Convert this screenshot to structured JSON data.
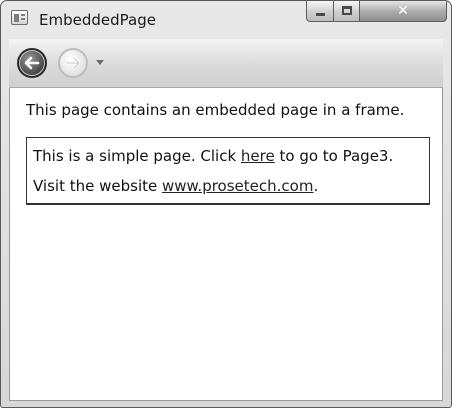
{
  "window": {
    "title": "EmbeddedPage",
    "app_icon": "page-icon",
    "caption_buttons": {
      "minimize": "minimize-icon",
      "maximize": "maximize-icon",
      "close": "✕"
    }
  },
  "nav": {
    "back_icon": "back-arrow-icon",
    "forward_icon": "forward-arrow-icon",
    "history_icon": "dropdown-arrow-icon"
  },
  "page": {
    "intro": "This page contains an embedded page in a frame.",
    "frame": {
      "line1_prefix": "This is a simple page. Click ",
      "line1_link": "here",
      "line1_suffix": " to go to Page3.",
      "line2_prefix": "Visit the website ",
      "line2_link": "www.prosetech.com",
      "line2_suffix": "."
    }
  }
}
